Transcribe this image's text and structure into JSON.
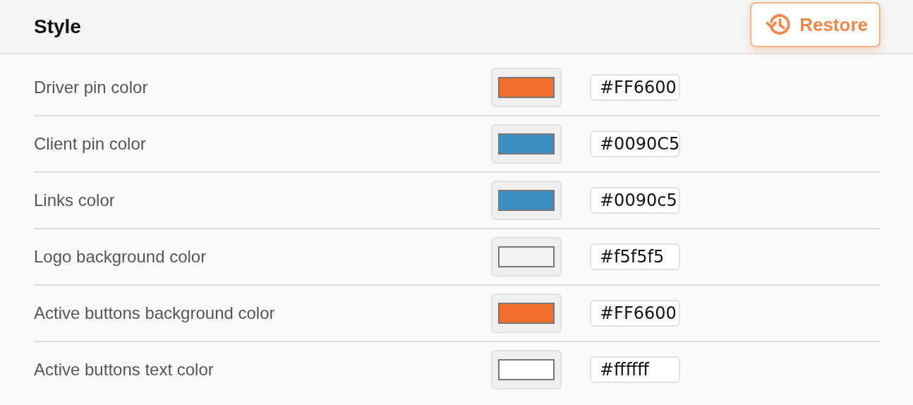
{
  "header": {
    "title": "Style",
    "restore_button": {
      "label": "Restore"
    }
  },
  "settings": [
    {
      "label": "Driver pin color",
      "color": "#ef6e2e",
      "value": "#FF6600"
    },
    {
      "label": "Client pin color",
      "color": "#3b8fc2",
      "value": "#0090C5"
    },
    {
      "label": "Links color",
      "color": "#3b8fc2",
      "value": "#0090c5"
    },
    {
      "label": "Logo background color",
      "color": "#f3f3f3",
      "value": "#f5f5f5"
    },
    {
      "label": "Active buttons background color",
      "color": "#ef6e2e",
      "value": "#FF6600"
    },
    {
      "label": "Active buttons text color",
      "color": "#ffffff",
      "value": "#ffffff"
    }
  ]
}
